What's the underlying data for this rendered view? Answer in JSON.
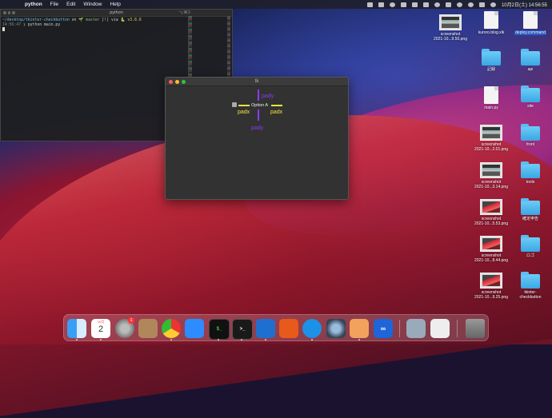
{
  "menubar": {
    "app_name": "python",
    "items": [
      "File",
      "Edit",
      "Window",
      "Help"
    ],
    "clock": "10月2日(土)  14:56:55"
  },
  "terminal": {
    "title": "python",
    "shortcut": "⌥⌘2",
    "line1": {
      "path": "~/desktop/tkinter-checkbutton",
      "on": " on ",
      "branch": "🌱 master",
      "status": " [!] via ",
      "py": "🐍 v3.8.6"
    },
    "line2": {
      "time": "14:56:47",
      "prompt": " ❯ ",
      "cmd": "python main.py"
    }
  },
  "tk_window": {
    "title": "tk",
    "checkbutton_label": "Option A",
    "pady_top": "pady",
    "pady_bottom": "pady",
    "padx_left": "padx",
    "padx_right": "padx"
  },
  "desktop_icons": [
    {
      "label1": "screenshot",
      "label2": "2021-10...9.50.png",
      "kind": "shot"
    },
    {
      "label1": "kuroro.blog.xlk",
      "label2": "",
      "kind": "doc"
    },
    {
      "label1": "deploy.command",
      "label2": "",
      "kind": "doc"
    },
    {
      "label1": "記録",
      "label2": "",
      "kind": "folder"
    },
    {
      "label1": "api",
      "label2": "",
      "kind": "folder"
    },
    {
      "label1": "main.py",
      "label2": "",
      "kind": "doc"
    },
    {
      "label1": "site",
      "label2": "",
      "kind": "folder"
    },
    {
      "label1": "screenshot",
      "label2": "2021-10...2.01.png",
      "kind": "shot"
    },
    {
      "label1": "front",
      "label2": "",
      "kind": "folder"
    },
    {
      "label1": "screenshot",
      "label2": "2021-10...3.14.png",
      "kind": "shot"
    },
    {
      "label1": "tools",
      "label2": "",
      "kind": "folder"
    },
    {
      "label1": "screenshot",
      "label2": "2021-10...5.53.png",
      "kind": "shot"
    },
    {
      "label1": "確定申告",
      "label2": "",
      "kind": "folder"
    },
    {
      "label1": "screenshot",
      "label2": "2021-10...8.44.png",
      "kind": "shot"
    },
    {
      "label1": "ロゴ",
      "label2": "",
      "kind": "folder"
    },
    {
      "label1": "screenshot",
      "label2": "2021-10...9.25.png",
      "kind": "shot"
    },
    {
      "label1": "tkinter-",
      "label2": "checkbutton",
      "kind": "folder"
    }
  ],
  "dock": {
    "calendar_month": "10月",
    "calendar_day": "2",
    "settings_badge": "1"
  }
}
